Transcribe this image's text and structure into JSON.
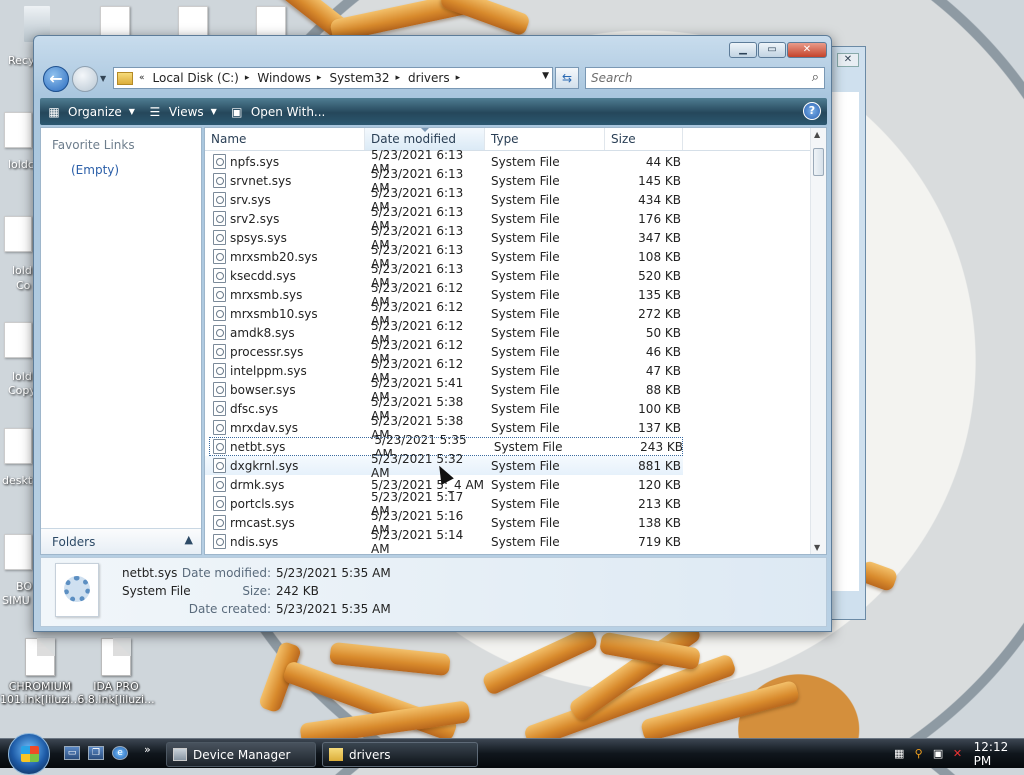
{
  "desktop": {
    "icons": [
      {
        "label": "Recy",
        "name": "recycle-bin"
      },
      {
        "label": "loldc",
        "name": "desktop-item-1"
      },
      {
        "label": "lold",
        "name": "desktop-item-2"
      },
      {
        "label": "Co",
        "name": "desktop-item-2b"
      },
      {
        "label": "lold",
        "name": "desktop-item-3"
      },
      {
        "label": "Copy",
        "name": "desktop-item-3b"
      },
      {
        "label": "deskt",
        "name": "desktop-item-4"
      },
      {
        "label": "BO",
        "name": "desktop-item-5"
      },
      {
        "label": "SIMU",
        "name": "desktop-item-5b"
      }
    ],
    "chromium_label": "CHROMIUM 101.lnk[liluzi...",
    "ida_label": "IDA PRO 6.8.lnk[liluzi..."
  },
  "window": {
    "controls": {
      "minimize": "▁",
      "maximize": "▭",
      "close": "✕"
    },
    "address": {
      "crumbs": [
        "Local Disk (C:)",
        "Windows",
        "System32",
        "drivers"
      ],
      "lead": "«",
      "separator": "▸"
    },
    "search_placeholder": "Search",
    "toolbar": {
      "organize": "Organize",
      "views": "Views",
      "open_with": "Open With...",
      "help": "?"
    },
    "left_pane": {
      "favorite_links": "Favorite Links",
      "empty": "(Empty)",
      "folders": "Folders"
    },
    "columns": {
      "name": "Name",
      "date": "Date modified",
      "type": "Type",
      "size": "Size"
    },
    "files": [
      {
        "name": "npfs.sys",
        "date": "5/23/2021 6:13 AM",
        "type": "System File",
        "size": "44 KB"
      },
      {
        "name": "srvnet.sys",
        "date": "5/23/2021 6:13 AM",
        "type": "System File",
        "size": "145 KB"
      },
      {
        "name": "srv.sys",
        "date": "5/23/2021 6:13 AM",
        "type": "System File",
        "size": "434 KB"
      },
      {
        "name": "srv2.sys",
        "date": "5/23/2021 6:13 AM",
        "type": "System File",
        "size": "176 KB"
      },
      {
        "name": "spsys.sys",
        "date": "5/23/2021 6:13 AM",
        "type": "System File",
        "size": "347 KB"
      },
      {
        "name": "mrxsmb20.sys",
        "date": "5/23/2021 6:13 AM",
        "type": "System File",
        "size": "108 KB"
      },
      {
        "name": "ksecdd.sys",
        "date": "5/23/2021 6:13 AM",
        "type": "System File",
        "size": "520 KB"
      },
      {
        "name": "mrxsmb.sys",
        "date": "5/23/2021 6:12 AM",
        "type": "System File",
        "size": "135 KB"
      },
      {
        "name": "mrxsmb10.sys",
        "date": "5/23/2021 6:12 AM",
        "type": "System File",
        "size": "272 KB"
      },
      {
        "name": "amdk8.sys",
        "date": "5/23/2021 6:12 AM",
        "type": "System File",
        "size": "50 KB"
      },
      {
        "name": "processr.sys",
        "date": "5/23/2021 6:12 AM",
        "type": "System File",
        "size": "46 KB"
      },
      {
        "name": "intelppm.sys",
        "date": "5/23/2021 6:12 AM",
        "type": "System File",
        "size": "47 KB"
      },
      {
        "name": "bowser.sys",
        "date": "5/23/2021 5:41 AM",
        "type": "System File",
        "size": "88 KB"
      },
      {
        "name": "dfsc.sys",
        "date": "5/23/2021 5:38 AM",
        "type": "System File",
        "size": "100 KB"
      },
      {
        "name": "mrxdav.sys",
        "date": "5/23/2021 5:38 AM",
        "type": "System File",
        "size": "137 KB"
      },
      {
        "name": "netbt.sys",
        "date": "5/23/2021 5:35 AM",
        "type": "System File",
        "size": "243 KB",
        "state": "selected"
      },
      {
        "name": "dxgkrnl.sys",
        "date": "5/23/2021 5:32 AM",
        "type": "System File",
        "size": "881 KB",
        "state": "hover"
      },
      {
        "name": "drmk.sys",
        "date": "5/23/2021 5:_4 AM",
        "type": "System File",
        "size": "120 KB"
      },
      {
        "name": "portcls.sys",
        "date": "5/23/2021 5:17 AM",
        "type": "System File",
        "size": "213 KB"
      },
      {
        "name": "rmcast.sys",
        "date": "5/23/2021 5:16 AM",
        "type": "System File",
        "size": "138 KB"
      },
      {
        "name": "ndis.sys",
        "date": "5/23/2021 5:14 AM",
        "type": "System File",
        "size": "719 KB"
      }
    ],
    "details": {
      "name": "netbt.sys",
      "type": "System File",
      "date_modified_label": "Date modified:",
      "date_modified": "5/23/2021 5:35 AM",
      "size_label": "Size:",
      "size": "242 KB",
      "date_created_label": "Date created:",
      "date_created": "5/23/2021 5:35 AM"
    }
  },
  "taskbar": {
    "quick_more": "»",
    "tasks": [
      {
        "label": "Device Manager",
        "name": "task-device-manager"
      },
      {
        "label": "drivers",
        "name": "task-drivers"
      }
    ],
    "clock": "12:12 PM"
  },
  "colors": {
    "toolbar": "#25475b",
    "selection_outline": "#3a6aa0",
    "link": "#2a5ea8"
  }
}
